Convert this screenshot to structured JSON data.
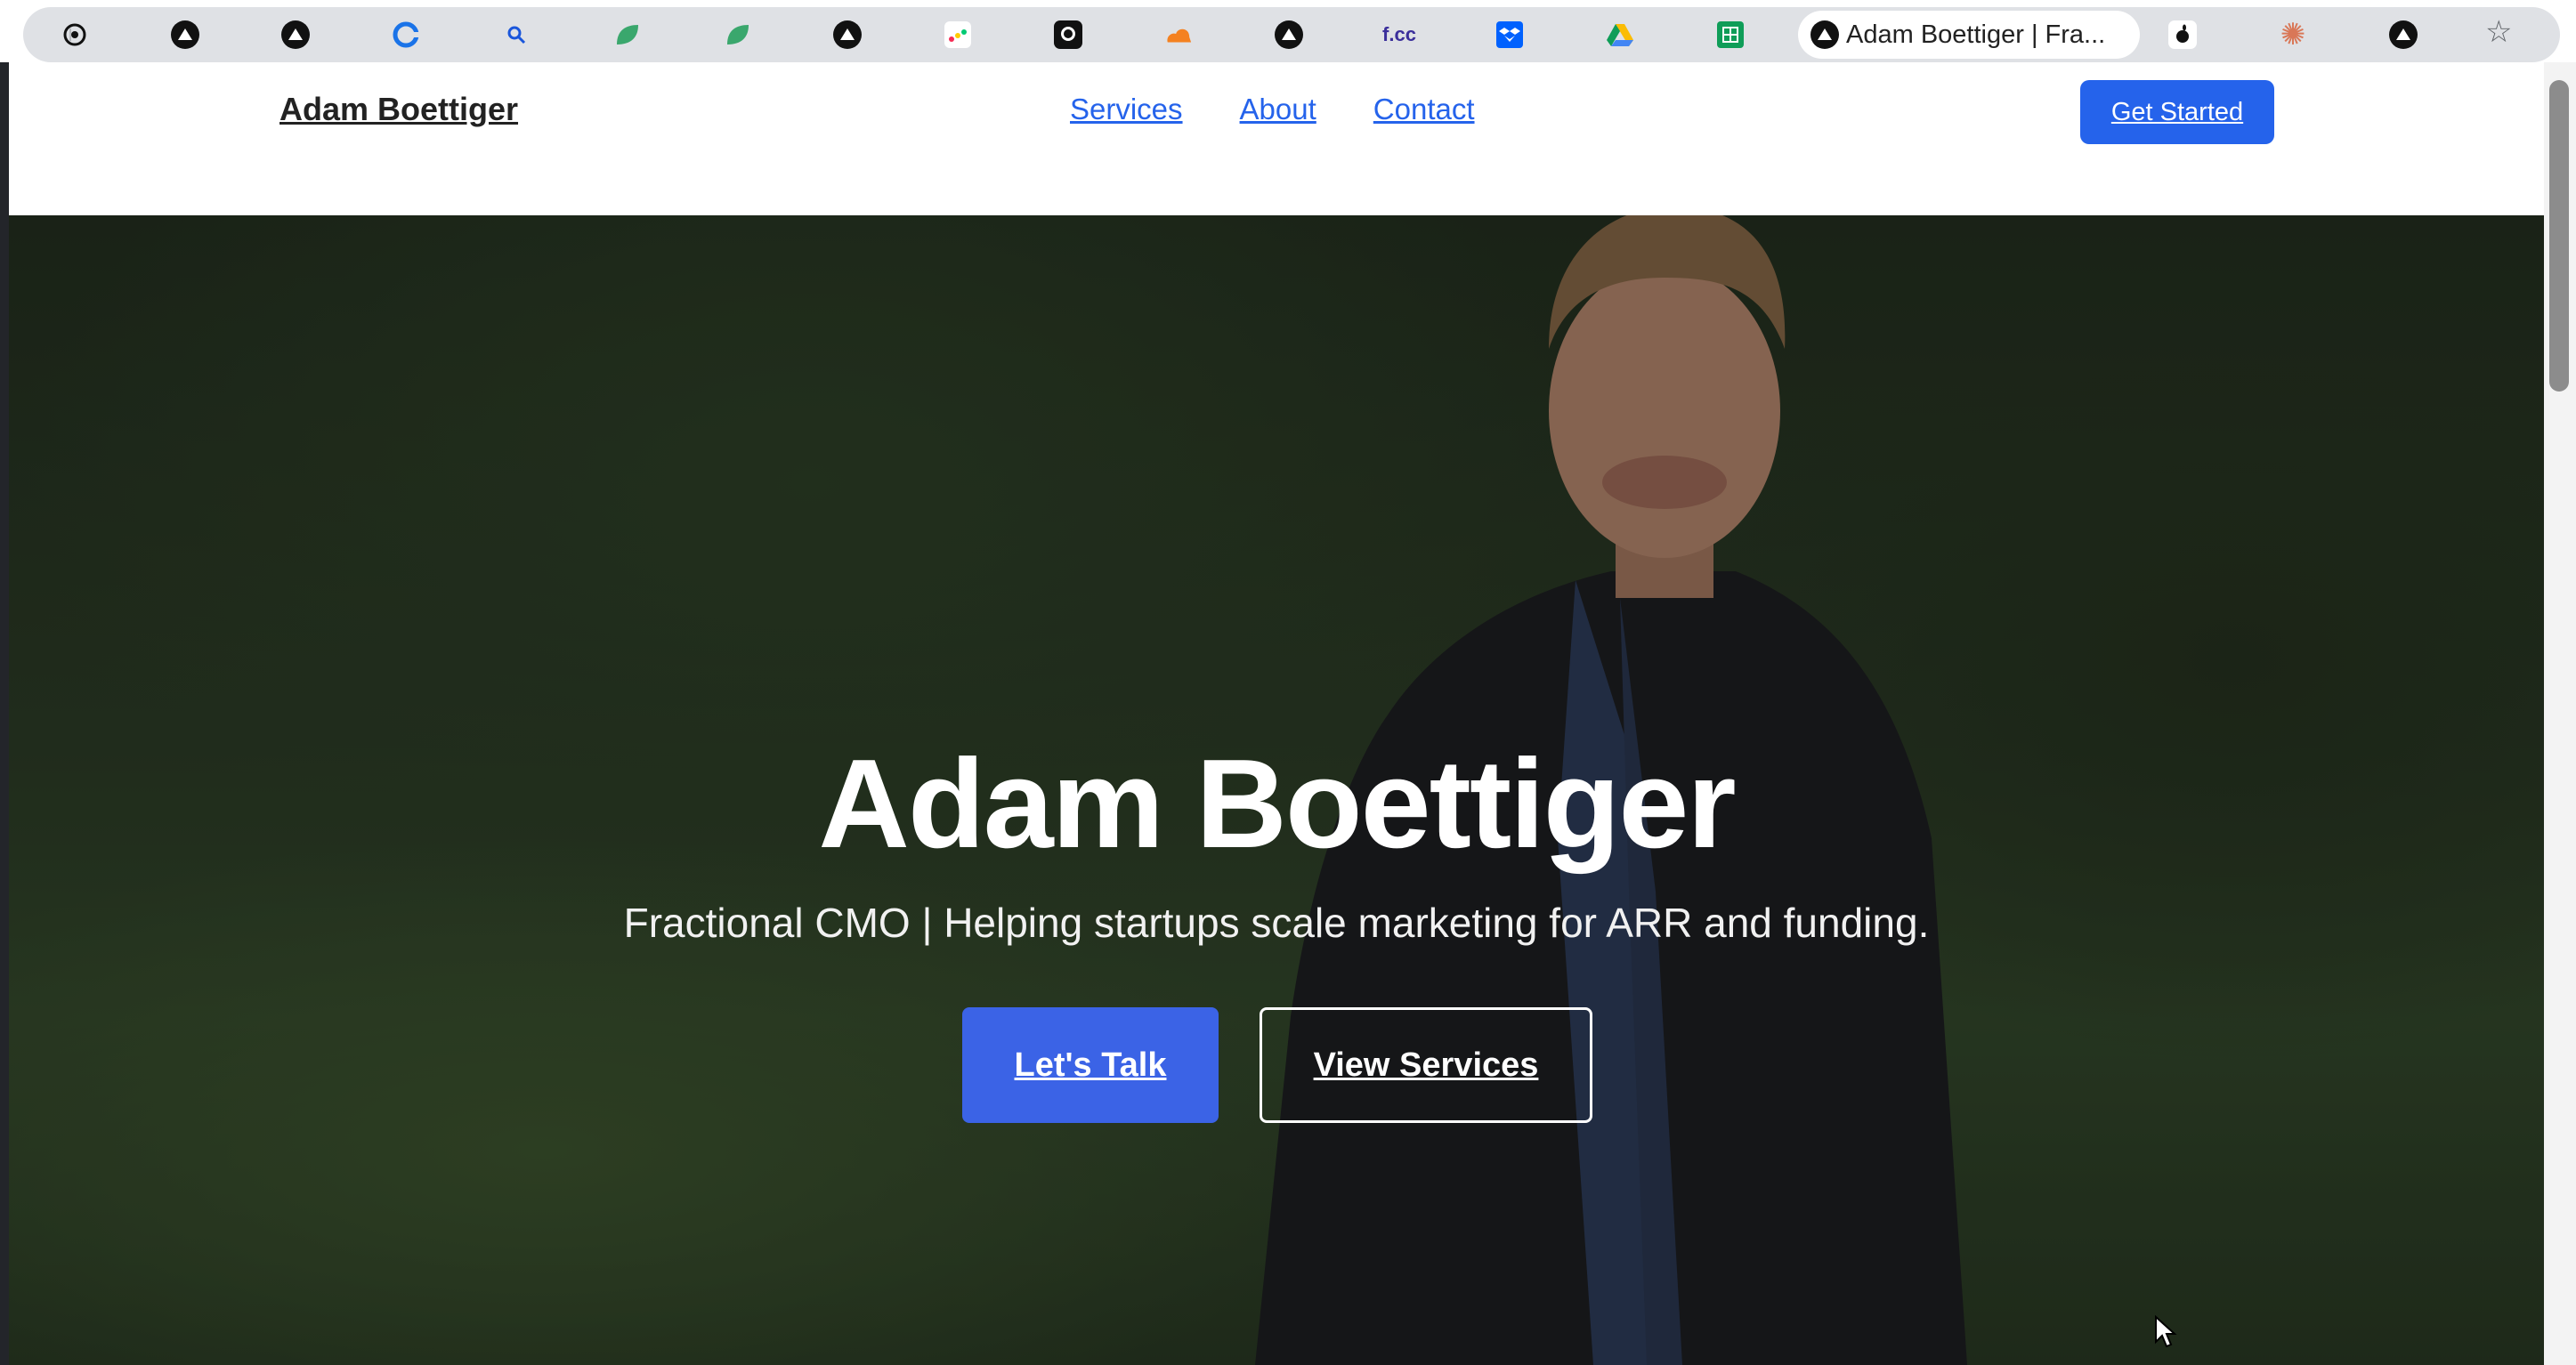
{
  "browser": {
    "active_tab_title": "Adam Boettiger | Fra...",
    "tab_icons": [
      "openai-icon",
      "triangle-icon",
      "triangle-icon",
      "chrome-c-icon",
      "search-icon",
      "leaf-icon",
      "leaf-icon",
      "triangle-icon",
      "monday-icon",
      "github-icon",
      "cloudflare-icon",
      "triangle-icon",
      "freecodecamp-icon",
      "dropbox-icon",
      "google-drive-icon",
      "google-sheets-icon",
      "apple-icon",
      "claude-icon",
      "triangle-icon"
    ],
    "bookmark_icon": "star-icon"
  },
  "nav": {
    "brand": "Adam Boettiger",
    "links": [
      "Services",
      "About",
      "Contact"
    ],
    "cta": "Get Started"
  },
  "hero": {
    "title": "Adam Boettiger",
    "subtitle": "Fractional CMO | Helping startups scale marketing for ARR and funding.",
    "primary_button": "Let's Talk",
    "secondary_button": "View Services"
  },
  "colors": {
    "accent": "#2563eb",
    "button_primary": "#3b63e6"
  }
}
